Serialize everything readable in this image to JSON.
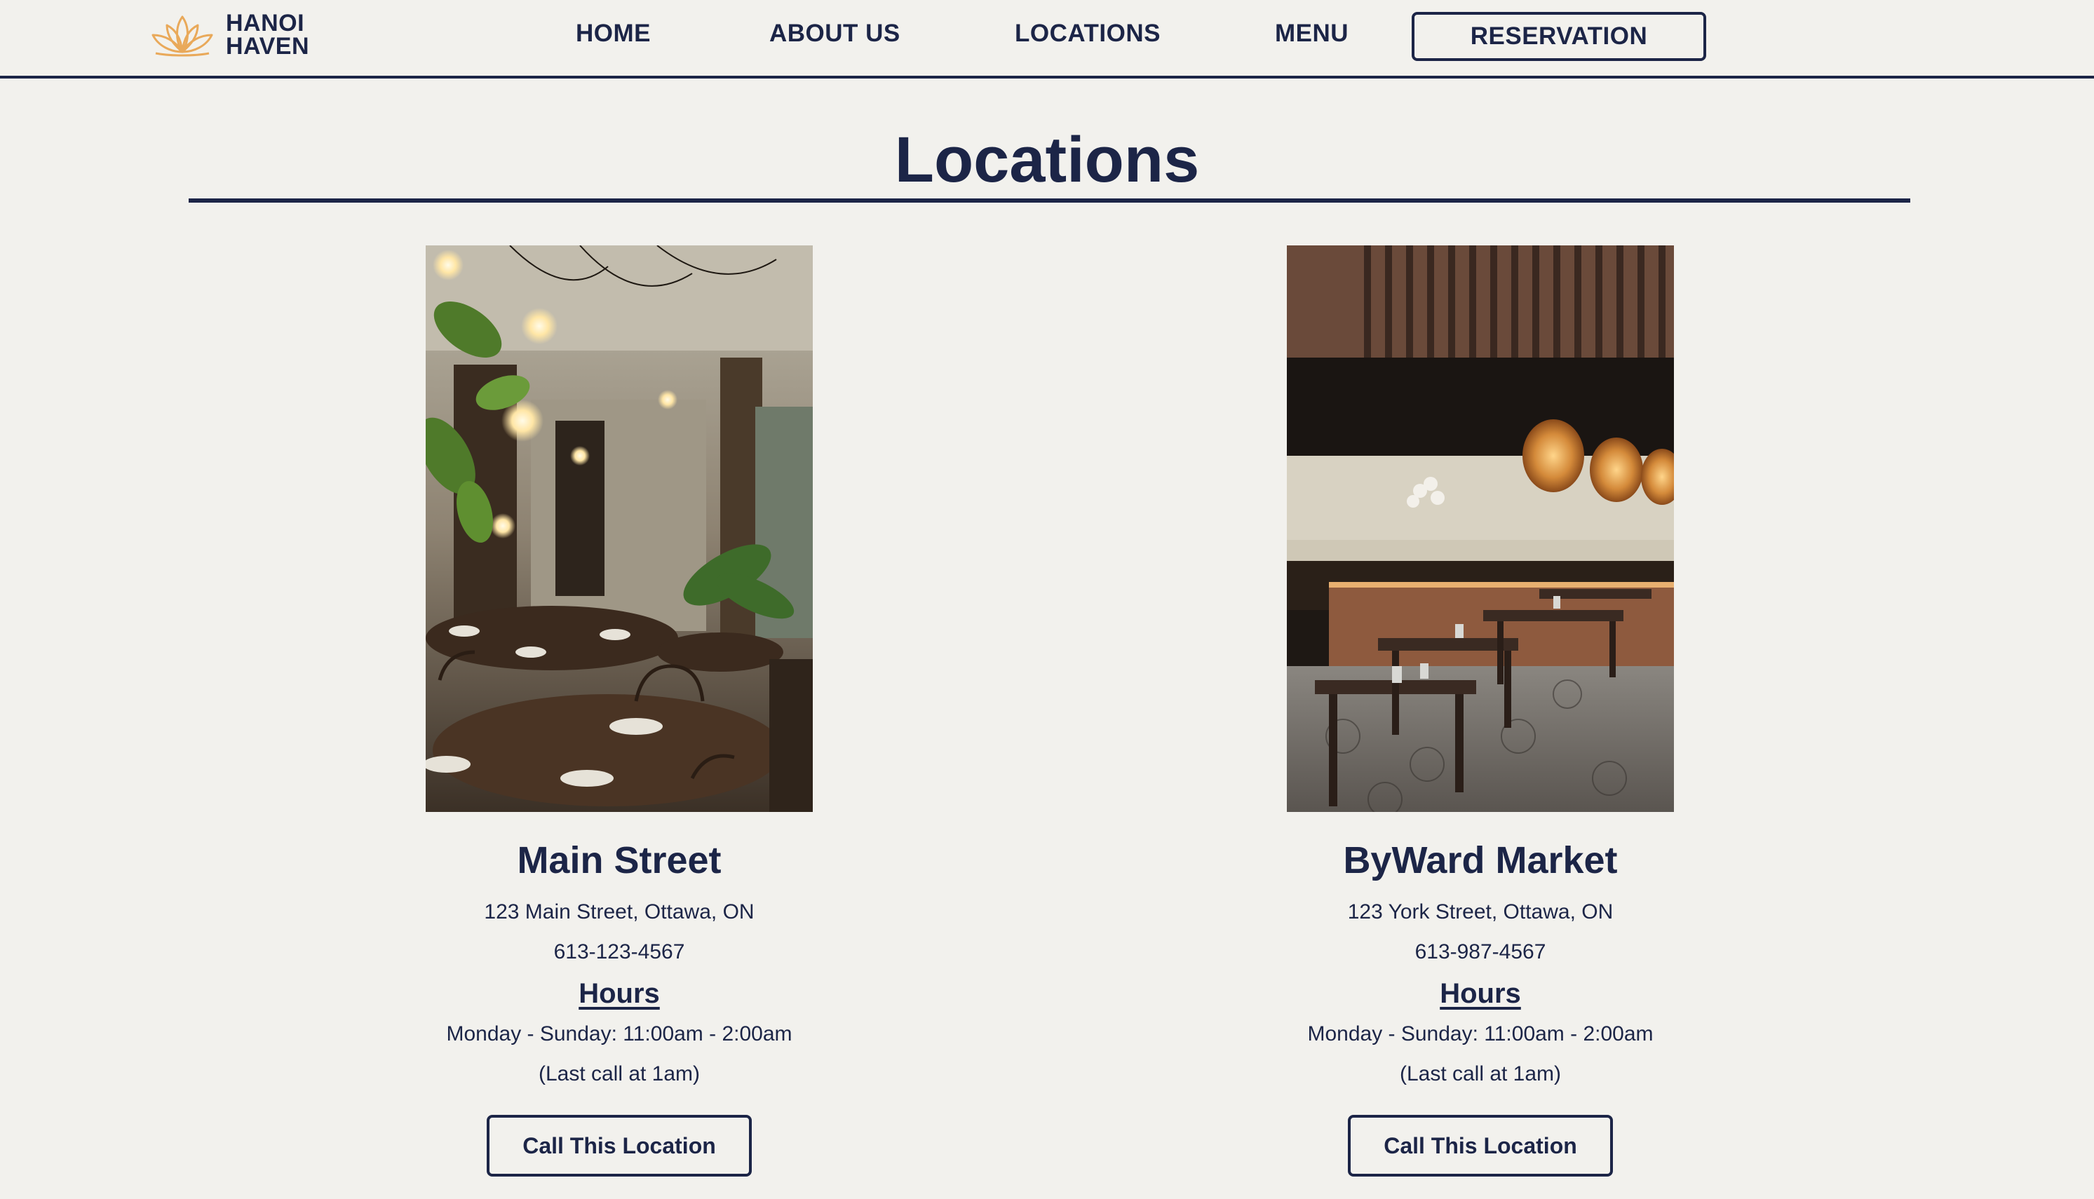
{
  "brand": {
    "name_line1": "HANOI",
    "name_line2": "HAVEN",
    "logo_icon": "lotus-icon",
    "accent_color": "#e9a95a",
    "primary_color": "#1c2547",
    "background_color": "#f2f1ed"
  },
  "nav": {
    "home": "HOME",
    "about": "ABOUT US",
    "locations": "LOCATIONS",
    "menu": "MENU",
    "reservation": "RESERVATION"
  },
  "page": {
    "title": "Locations"
  },
  "locations": [
    {
      "name": "Main Street",
      "address": "123 Main Street, Ottawa, ON",
      "phone": "613-123-4567",
      "hours_heading": "Hours",
      "hours": "Monday - Sunday: 11:00am - 2:00am",
      "last_call": "(Last call at 1am)",
      "button": "Call This Location"
    },
    {
      "name": "ByWard Market",
      "address": "123 York Street, Ottawa, ON",
      "phone": "613-987-4567",
      "hours_heading": "Hours",
      "hours": "Monday - Sunday: 11:00am - 2:00am",
      "last_call": "(Last call at 1am)",
      "button": "Call This Location"
    }
  ]
}
